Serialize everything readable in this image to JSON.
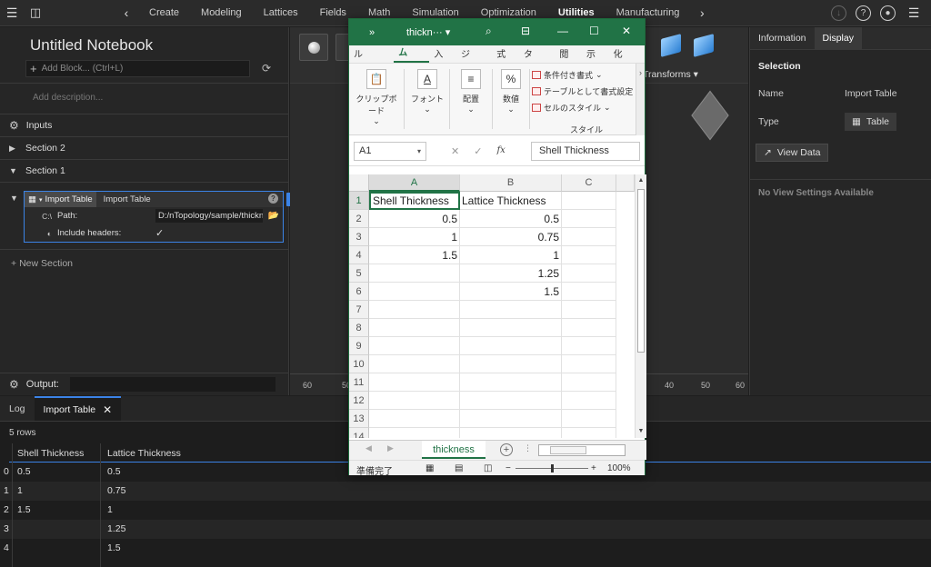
{
  "topbar": {
    "tabs": [
      "Create",
      "Modeling",
      "Lattices",
      "Fields",
      "Math",
      "Simulation",
      "Optimization",
      "Utilities",
      "Manufacturing"
    ],
    "active_tab": "Utilities"
  },
  "notebook": {
    "title": "Untitled Notebook",
    "add_block_placeholder": "Add Block... (Ctrl+L)",
    "add_description": "Add description...",
    "inputs_label": "Inputs",
    "section2_label": "Section 2",
    "section1_label": "Section 1",
    "block": {
      "type_label": "Import Table",
      "name": "Import Table",
      "path_icon": "C:\\",
      "path_label": "Path:",
      "path_value": "D:/nTopology/sample/thickness.xlsx",
      "headers_label": "Include headers:",
      "headers_value": "✓"
    },
    "new_section": "New Section",
    "output_label": "Output:"
  },
  "viewport": {
    "transforms_label": "Transforms",
    "ruler_labels": [
      "60",
      "50",
      "40",
      "50",
      "60"
    ]
  },
  "right_panel": {
    "tabs": [
      "Information",
      "Display"
    ],
    "active_tab": "Display",
    "section_title": "Selection",
    "name_key": "Name",
    "name_value": "Import Table",
    "type_key": "Type",
    "type_value": "Table",
    "view_data_label": "View Data",
    "no_view_settings": "No View Settings Available"
  },
  "bottom_panel": {
    "tabs": [
      "Log",
      "Import Table"
    ],
    "active_tab": "Import Table",
    "rows_count": "5 rows",
    "columns": [
      "Shell Thickness",
      "Lattice Thickness"
    ],
    "rows": [
      {
        "idx": "0",
        "c1": "0.5",
        "c2": "0.5"
      },
      {
        "idx": "1",
        "c1": "1",
        "c2": "0.75"
      },
      {
        "idx": "2",
        "c1": "1.5",
        "c2": "1"
      },
      {
        "idx": "3",
        "c1": "",
        "c2": "1.25"
      },
      {
        "idx": "4",
        "c1": "",
        "c2": "1.5"
      }
    ]
  },
  "excel": {
    "filename": "thickn···",
    "ribbon_tabs": [
      "ファイル",
      "ホーム",
      "挿入",
      "ページ",
      "数式",
      "データ",
      "校閲",
      "表示",
      "自動化"
    ],
    "active_ribbon_tab": "ホーム",
    "groups": {
      "clipboard": "クリップボード",
      "font": "フォント",
      "align": "配置",
      "number": "数値",
      "style": "スタイル"
    },
    "style_items": [
      "条件付き書式",
      "テーブルとして書式設定",
      "セルのスタイル"
    ],
    "name_box": "A1",
    "formula_value": "Shell Thickness",
    "col_headers": [
      "A",
      "B",
      "C"
    ],
    "row_headers": [
      "1",
      "2",
      "3",
      "4",
      "5",
      "6",
      "7",
      "8",
      "9",
      "10",
      "11",
      "12",
      "13",
      "14"
    ],
    "cells": {
      "A1": "Shell Thickness",
      "B1": "Lattice Thickness",
      "A2": "0.5",
      "B2": "0.5",
      "A3": "1",
      "B3": "0.75",
      "A4": "1.5",
      "B4": "1",
      "B5": "1.25",
      "B6": "1.5"
    },
    "sheet_name": "thickness",
    "status_ready": "準備完了",
    "zoom": "100%"
  }
}
